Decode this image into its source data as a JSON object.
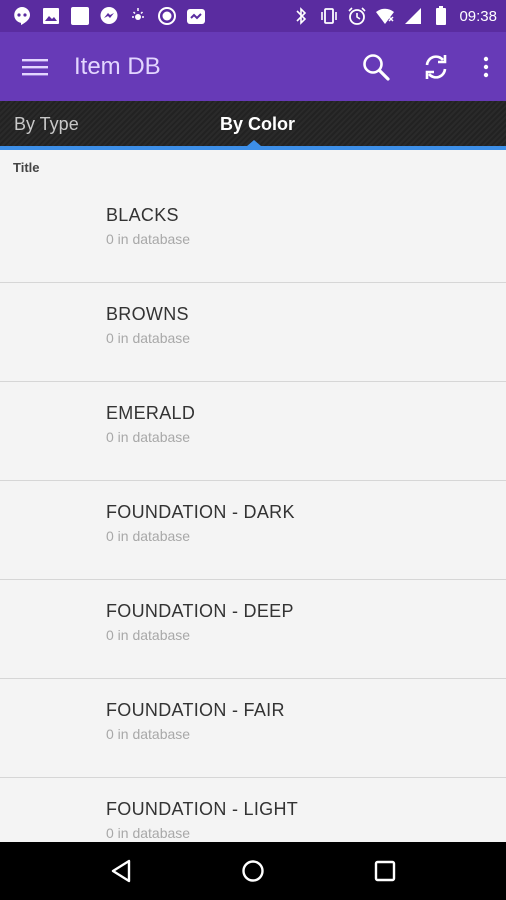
{
  "status_bar": {
    "time": "09:38",
    "left_icons": [
      "hangouts-icon",
      "image-icon",
      "white-square-icon",
      "messenger-icon",
      "brightness-icon",
      "camera-shutter-icon",
      "photo-app-icon"
    ],
    "right_icons": [
      "bluetooth-icon",
      "vibrate-icon",
      "alarm-icon",
      "wifi-icon",
      "signal-icon",
      "battery-icon"
    ]
  },
  "app_bar": {
    "title": "Item DB",
    "background": "#673ab7"
  },
  "tabs": [
    {
      "label": "By Type",
      "selected": false
    },
    {
      "label": "By Color",
      "selected": true
    }
  ],
  "list": {
    "section_title": "Title",
    "items": [
      {
        "title": "BLACKS",
        "subtitle": "0 in database"
      },
      {
        "title": "BROWNS",
        "subtitle": "0 in database"
      },
      {
        "title": "EMERALD",
        "subtitle": "0 in database"
      },
      {
        "title": "FOUNDATION - DARK",
        "subtitle": "0 in database"
      },
      {
        "title": "FOUNDATION - DEEP",
        "subtitle": "0 in database"
      },
      {
        "title": "FOUNDATION - FAIR",
        "subtitle": "0 in database"
      },
      {
        "title": "FOUNDATION - LIGHT",
        "subtitle": "0 in database"
      }
    ]
  },
  "nav_bar": {
    "buttons": [
      "back-icon",
      "home-icon",
      "recents-icon"
    ]
  },
  "colors": {
    "status_bar": "#5a2ca0",
    "app_bar": "#673ab7",
    "tab_indicator": "#3d8fe8",
    "list_background": "#f4f4f4"
  }
}
